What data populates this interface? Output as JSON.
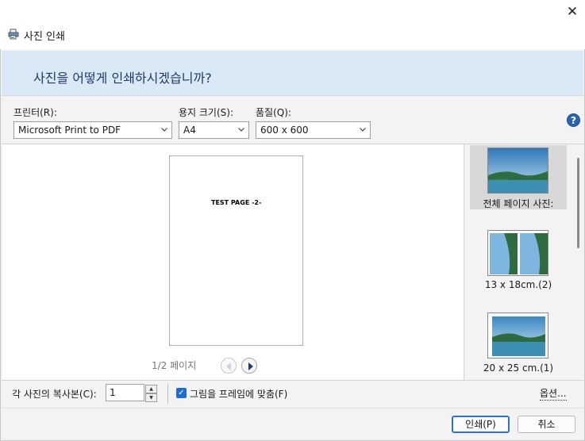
{
  "window": {
    "title": "사진 인쇄",
    "close_glyph": "✕",
    "icon": "printer-icon"
  },
  "banner": {
    "question": "사진을 어떻게 인쇄하시겠습니까?"
  },
  "settings": {
    "printer_label": "프린터(R):",
    "printer_value": "Microsoft Print to PDF",
    "paper_label": "용지 크기(S):",
    "paper_value": "A4",
    "quality_label": "품질(Q):",
    "quality_value": "600 x 600",
    "help_glyph": "?"
  },
  "preview": {
    "page_text": "TEST PAGE -2-",
    "page_info": "1/2 페이지"
  },
  "layouts": [
    {
      "label": "전체 페이지 사진:",
      "selected": true
    },
    {
      "label": "13 x 18cm.(2)",
      "selected": false
    },
    {
      "label": "20 x 25 cm.(1)",
      "selected": false
    }
  ],
  "bottom": {
    "copies_label": "각 사진의 복사본(C):",
    "copies_value": "1",
    "fit_label": "그림을 프레임에 맞춤(F)",
    "fit_checked": true,
    "options_link": "옵션..."
  },
  "footer": {
    "print_label": "인쇄(P)",
    "cancel_label": "취소"
  },
  "colors": {
    "banner_bg": "#dbe8f6",
    "accent": "#1c6fd1"
  }
}
